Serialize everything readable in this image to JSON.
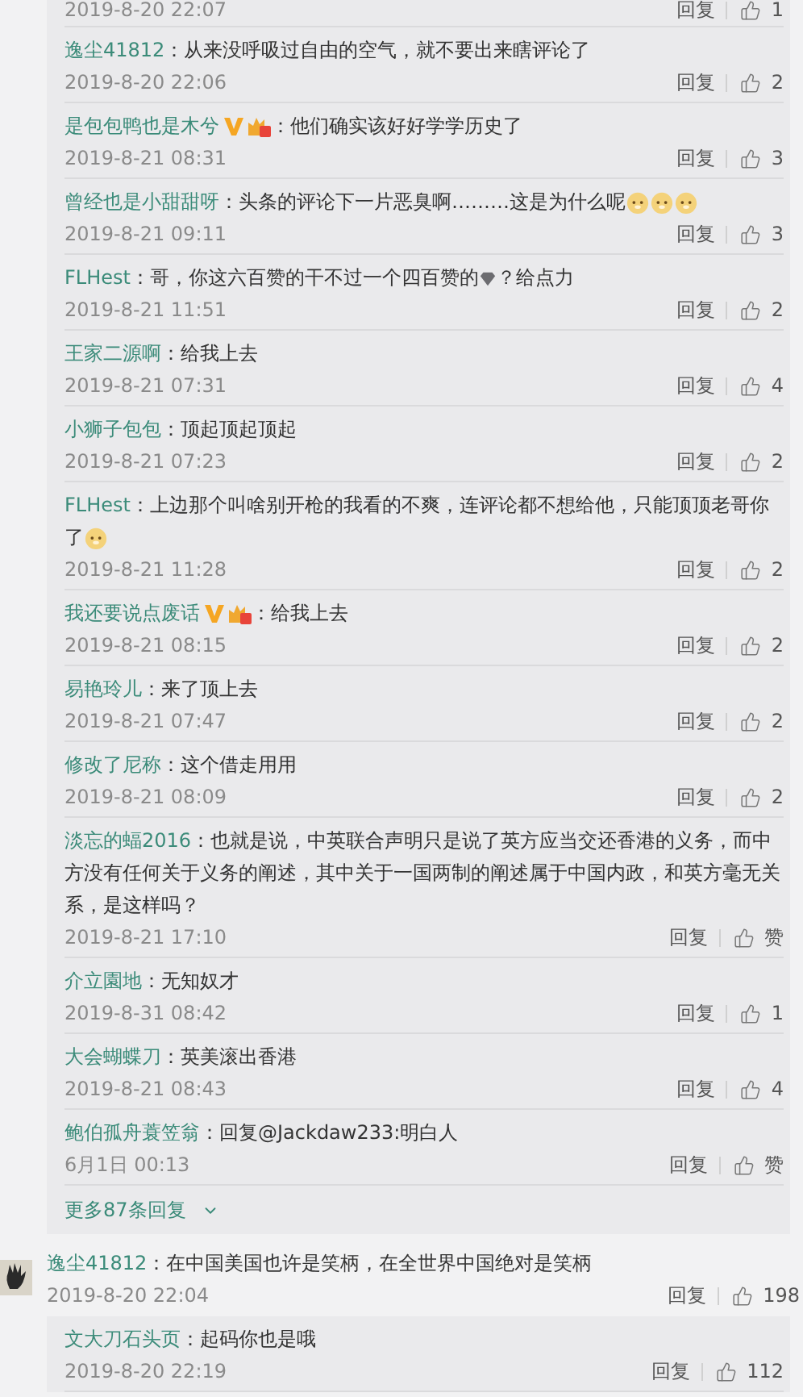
{
  "reply_panel": {
    "cut_row": {
      "time": "2019-8-20 22:07",
      "reply_label": "回复",
      "likes": "1"
    },
    "replies": [
      {
        "user": "逸尘41812",
        "parts": [
          {
            "kind": "text",
            "text": "：从来没呼吸过自由的空气，就不要出来瞎评论了"
          }
        ],
        "time": "2019-8-20 22:06",
        "reply_label": "回复",
        "likes": "2"
      },
      {
        "user": "是包包鸭也是木兮",
        "badges": [
          {
            "kind": "verified"
          },
          {
            "kind": "vip"
          }
        ],
        "parts": [
          {
            "kind": "text",
            "text": "：他们确实该好好学学历史了"
          }
        ],
        "time": "2019-8-21 08:31",
        "reply_label": "回复",
        "likes": "3"
      },
      {
        "user": "曾经也是小甜甜呀",
        "parts": [
          {
            "kind": "text",
            "text": "：头条的评论下一片恶臭啊………这是为什么呢"
          },
          {
            "kind": "emoji"
          },
          {
            "kind": "emoji"
          },
          {
            "kind": "emoji"
          }
        ],
        "time": "2019-8-21 09:11",
        "reply_label": "回复",
        "likes": "3"
      },
      {
        "user": "FLHest",
        "parts": [
          {
            "kind": "text",
            "text": "：哥，你这六百赞的干不过一个四百赞的"
          },
          {
            "kind": "gem"
          },
          {
            "kind": "text",
            "text": "？给点力"
          }
        ],
        "time": "2019-8-21 11:51",
        "reply_label": "回复",
        "likes": "2"
      },
      {
        "user": "王家二源啊",
        "parts": [
          {
            "kind": "text",
            "text": "：给我上去"
          }
        ],
        "time": "2019-8-21 07:31",
        "reply_label": "回复",
        "likes": "4"
      },
      {
        "user": "小狮子包包",
        "parts": [
          {
            "kind": "text",
            "text": "：顶起顶起顶起"
          }
        ],
        "time": "2019-8-21 07:23",
        "reply_label": "回复",
        "likes": "2"
      },
      {
        "user": "FLHest",
        "parts": [
          {
            "kind": "text",
            "text": "：上边那个叫啥别开枪的我看的不爽，连评论都不想给他，只能顶顶老哥你"
          },
          {
            "kind": "line",
            "text": "了"
          },
          {
            "kind": "emoji"
          }
        ],
        "time": "2019-8-21 11:28",
        "reply_label": "回复",
        "likes": "2"
      },
      {
        "user": "我还要说点废话",
        "badges": [
          {
            "kind": "verified"
          },
          {
            "kind": "vip"
          }
        ],
        "parts": [
          {
            "kind": "text",
            "text": "：给我上去"
          }
        ],
        "time": "2019-8-21 08:15",
        "reply_label": "回复",
        "likes": "2"
      },
      {
        "user": "易艳玲儿",
        "parts": [
          {
            "kind": "text",
            "text": "：来了顶上去"
          }
        ],
        "time": "2019-8-21 07:47",
        "reply_label": "回复",
        "likes": "2"
      },
      {
        "user": "修改了尼称",
        "parts": [
          {
            "kind": "text",
            "text": "：这个借走用用"
          }
        ],
        "time": "2019-8-21 08:09",
        "reply_label": "回复",
        "likes": "2"
      },
      {
        "user": "淡忘的蝠2016",
        "parts": [
          {
            "kind": "text",
            "text": "：也就是说，中英联合声明只是说了英方应当交还香港的义务，而中"
          },
          {
            "kind": "line",
            "text": "方没有任何关于义务的阐述，其中关于一国两制的阐述属于中国内政，和英方毫无关"
          },
          {
            "kind": "line",
            "text": "系，是这样吗？"
          }
        ],
        "time": "2019-8-21 17:10",
        "reply_label": "回复",
        "likes": "赞"
      },
      {
        "user": "介立園地",
        "parts": [
          {
            "kind": "text",
            "text": "：无知奴才"
          }
        ],
        "time": "2019-8-31 08:42",
        "reply_label": "回复",
        "likes": "1"
      },
      {
        "user": "大会蝴蝶刀",
        "parts": [
          {
            "kind": "text",
            "text": "：英美滚出香港"
          }
        ],
        "time": "2019-8-21 08:43",
        "reply_label": "回复",
        "likes": "4"
      },
      {
        "user": "鲍伯孤舟蓑笠翁",
        "parts": [
          {
            "kind": "text",
            "text": "：回复@Jackdaw233:明白人"
          }
        ],
        "time": "6月1日 00:13",
        "reply_label": "回复",
        "likes": "赞"
      }
    ],
    "more_replies": "更多87条回复"
  },
  "comment": {
    "user": "逸尘41812",
    "parts": [
      {
        "kind": "text",
        "text": "：在中国美国也许是笑柄，在全世界中国绝对是笑柄"
      }
    ],
    "time": "2019-8-20 22:04",
    "reply_label": "回复",
    "likes": "198"
  },
  "sub_replies": [
    {
      "user": "文大刀石头页",
      "parts": [
        {
          "kind": "text",
          "text": "：起码你也是哦"
        }
      ],
      "time": "2019-8-20 22:19",
      "reply_label": "回复",
      "likes": "112"
    }
  ]
}
